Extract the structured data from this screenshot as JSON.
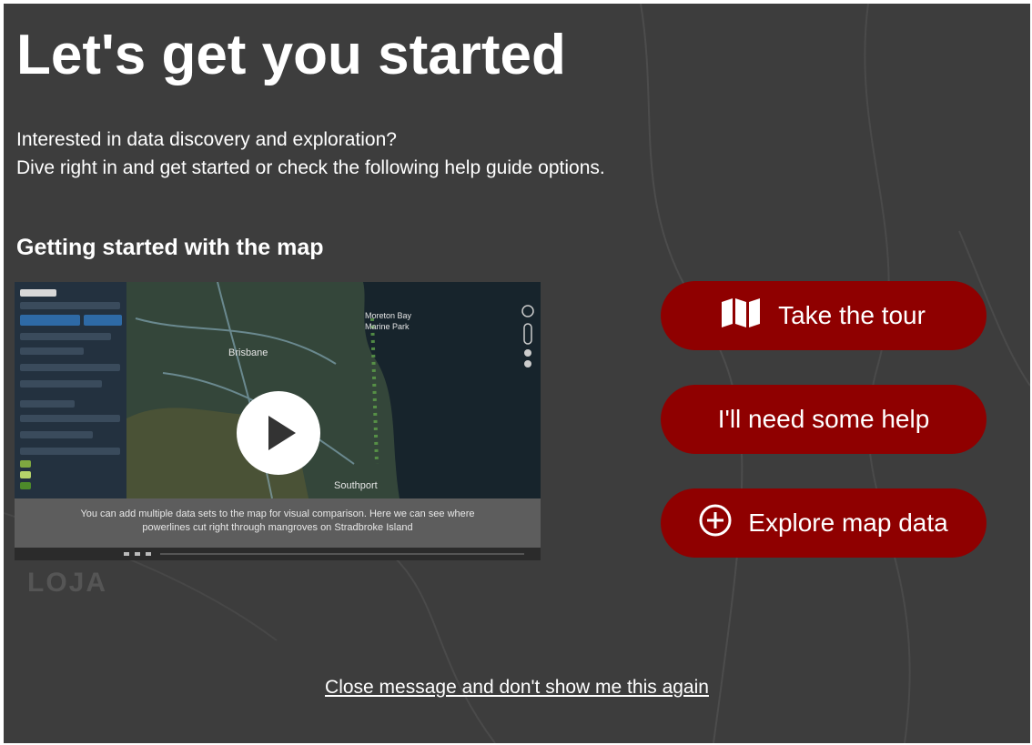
{
  "overlay": {
    "title": "Let's get you started",
    "intro_line1": "Interested in data discovery and exploration?",
    "intro_line2": "Dive right in and get started or check the following help guide options.",
    "section_title": "Getting started with the map",
    "background_place_label": "LOJA"
  },
  "video": {
    "caption_line1": "You can add multiple data sets to the map for visual comparison. Here we can see where",
    "caption_line2": "powerlines cut right through mangroves on Stradbroke Island",
    "map_labels": {
      "bay": "Moreton Bay",
      "park": "Marine Park",
      "city": "Brisbane",
      "town": "Southport"
    },
    "play_icon": "play-icon"
  },
  "actions": [
    {
      "label": "Take the tour",
      "icon": "map-icon"
    },
    {
      "label": "I'll need some help",
      "icon": ""
    },
    {
      "label": "Explore map data",
      "icon": "plus-circle-icon"
    }
  ],
  "close_link": "Close message and don't show me this again",
  "colors": {
    "overlay_bg": "#3d3d3d",
    "button_bg": "#8f0000",
    "text": "#ffffff"
  }
}
